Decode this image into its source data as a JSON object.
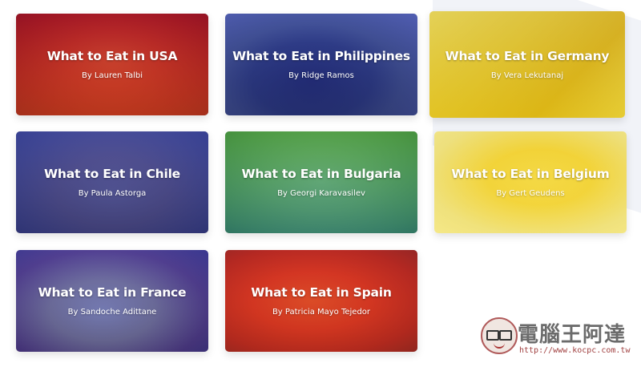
{
  "cards": [
    {
      "title": "What to Eat in USA",
      "author": "By Lauren Talbi"
    },
    {
      "title": "What to Eat in Philippines",
      "author": "By Ridge Ramos"
    },
    {
      "title": "What to Eat in Germany",
      "author": "By Vera Lekutanaj"
    },
    {
      "title": "What to Eat in Chile",
      "author": "By Paula Astorga"
    },
    {
      "title": "What to Eat in Bulgaria",
      "author": "By Georgi Karavasilev"
    },
    {
      "title": "What to Eat in Belgium",
      "author": "By Gert Geudens"
    },
    {
      "title": "What to Eat in France",
      "author": "By Sandoche Adittane"
    },
    {
      "title": "What to Eat in Spain",
      "author": "By Patricia Mayo Tejedor"
    }
  ],
  "watermark": {
    "name": "電腦王阿達",
    "url": "http://www.kocpc.com.tw"
  }
}
